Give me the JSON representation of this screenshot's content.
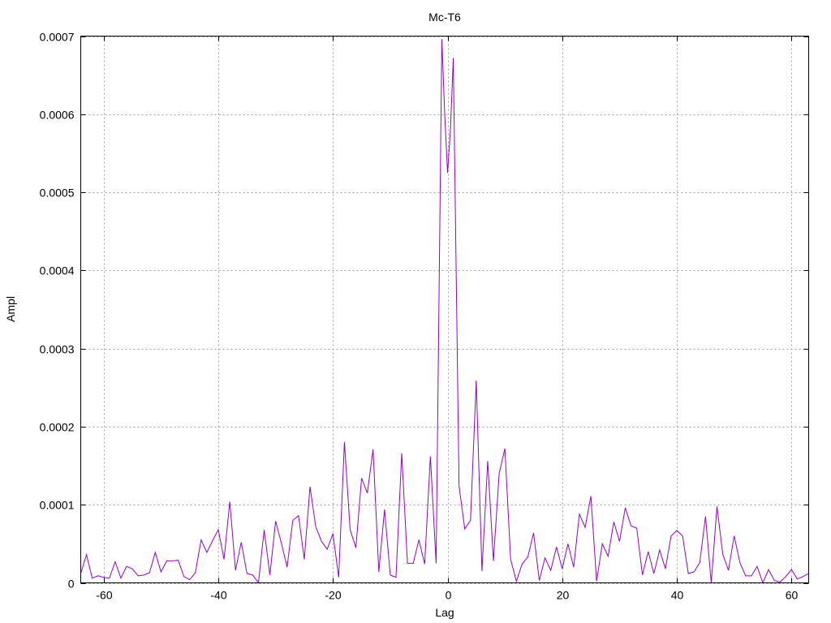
{
  "chart_data": {
    "type": "line",
    "title": "Mc-T6",
    "xlabel": "Lag",
    "ylabel": "Ampl",
    "xlim": [
      -64,
      63
    ],
    "ylim": [
      0,
      0.0007
    ],
    "grid": true,
    "x_ticks": [
      -60,
      -40,
      -20,
      0,
      20,
      40,
      60
    ],
    "x_tick_labels": [
      "-60",
      "-40",
      "-20",
      "0",
      "20",
      "40",
      "60"
    ],
    "y_ticks": [
      0,
      0.0001,
      0.0002,
      0.0003,
      0.0004,
      0.0005,
      0.0006,
      0.0007
    ],
    "y_tick_labels": [
      "0",
      "0.0001",
      "0.0002",
      "0.0003",
      "0.0004",
      "0.0005",
      "0.0006",
      "0.0007"
    ],
    "series": [
      {
        "color": "#9400d3",
        "x": [
          -64,
          -63,
          -62,
          -61,
          -60,
          -59,
          -58,
          -57,
          -56,
          -55,
          -54,
          -53,
          -52,
          -51,
          -50,
          -49,
          -48,
          -47,
          -46,
          -45,
          -44,
          -43,
          -42,
          -41,
          -40,
          -39,
          -38,
          -37,
          -36,
          -35,
          -34,
          -33,
          -32,
          -31,
          -30,
          -29,
          -28,
          -27,
          -26,
          -25,
          -24,
          -23,
          -22,
          -21,
          -20,
          -19,
          -18,
          -17,
          -16,
          -15,
          -14,
          -13,
          -12,
          -11,
          -10,
          -9,
          -8,
          -7,
          -6,
          -5,
          -4,
          -3,
          -2,
          -1,
          -0.5,
          0,
          0.5,
          1,
          2,
          3,
          4,
          5,
          6,
          7,
          8,
          9,
          10,
          11,
          12,
          13,
          14,
          15,
          16,
          17,
          18,
          19,
          20,
          21,
          22,
          23,
          24,
          25,
          26,
          27,
          28,
          29,
          30,
          31,
          32,
          33,
          34,
          35,
          36,
          37,
          38,
          39,
          40,
          41,
          42,
          43,
          44,
          45,
          46,
          47,
          48,
          49,
          50,
          51,
          52,
          53,
          54,
          55,
          56,
          57,
          58,
          59,
          60,
          61,
          62,
          63
        ],
        "values": [
          1.2e-05,
          3.6e-05,
          6e-06,
          9e-06,
          7e-06,
          6e-06,
          2.7e-05,
          6e-06,
          2.1e-05,
          1.8e-05,
          9e-06,
          1e-05,
          1.3e-05,
          3.9e-05,
          1.4e-05,
          2.8e-05,
          2.8e-05,
          2.9e-05,
          8e-06,
          4e-06,
          1.3e-05,
          5.5e-05,
          3.9e-05,
          5.4e-05,
          6.8e-05,
          3e-05,
          0.000104,
          1.6e-05,
          5.2e-05,
          1.2e-05,
          1e-05,
          0.0,
          6.8e-05,
          1e-05,
          7.9e-05,
          5.1e-05,
          2e-05,
          8e-05,
          8.6e-05,
          3e-05,
          0.000123,
          7.2e-05,
          5.3e-05,
          4.3e-05,
          6.3e-05,
          7e-06,
          0.00018,
          6.8e-05,
          4.5e-05,
          0.000134,
          0.000115,
          0.000171,
          1.4e-05,
          9.4e-05,
          1e-05,
          7e-06,
          0.000166,
          2.5e-05,
          2.5e-05,
          5.5e-05,
          2.4e-05,
          0.000162,
          2.5e-05,
          0.000696,
          0.0006,
          0.000525,
          0.00058,
          0.000672,
          0.000124,
          6.9e-05,
          8e-05,
          0.000259,
          1.5e-05,
          0.000156,
          2.8e-05,
          0.00014,
          0.000172,
          3e-05,
          2e-06,
          2.4e-05,
          3.3e-05,
          6.4e-05,
          3e-06,
          3.2e-05,
          1.6e-05,
          4.6e-05,
          1.8e-05,
          5e-05,
          2e-05,
          8.8e-05,
          7.1e-05,
          0.000111,
          2e-06,
          5e-05,
          3.4e-05,
          7.8e-05,
          5.3e-05,
          9.6e-05,
          7.3e-05,
          7e-05,
          1e-05,
          4e-05,
          1.2e-05,
          4.2e-05,
          1.8e-05,
          6e-05,
          6.7e-05,
          6e-05,
          1.2e-05,
          1.4e-05,
          2.6e-05,
          8.5e-05,
          0.0,
          9.8e-05,
          3.7e-05,
          1.6e-05,
          6e-05,
          2.6e-05,
          9e-06,
          9e-06,
          2.1e-05,
          0.0,
          1.7e-05,
          3e-06,
          1e-06,
          8e-06,
          1.7e-05,
          5e-06,
          8e-06,
          1.2e-05
        ]
      }
    ]
  }
}
